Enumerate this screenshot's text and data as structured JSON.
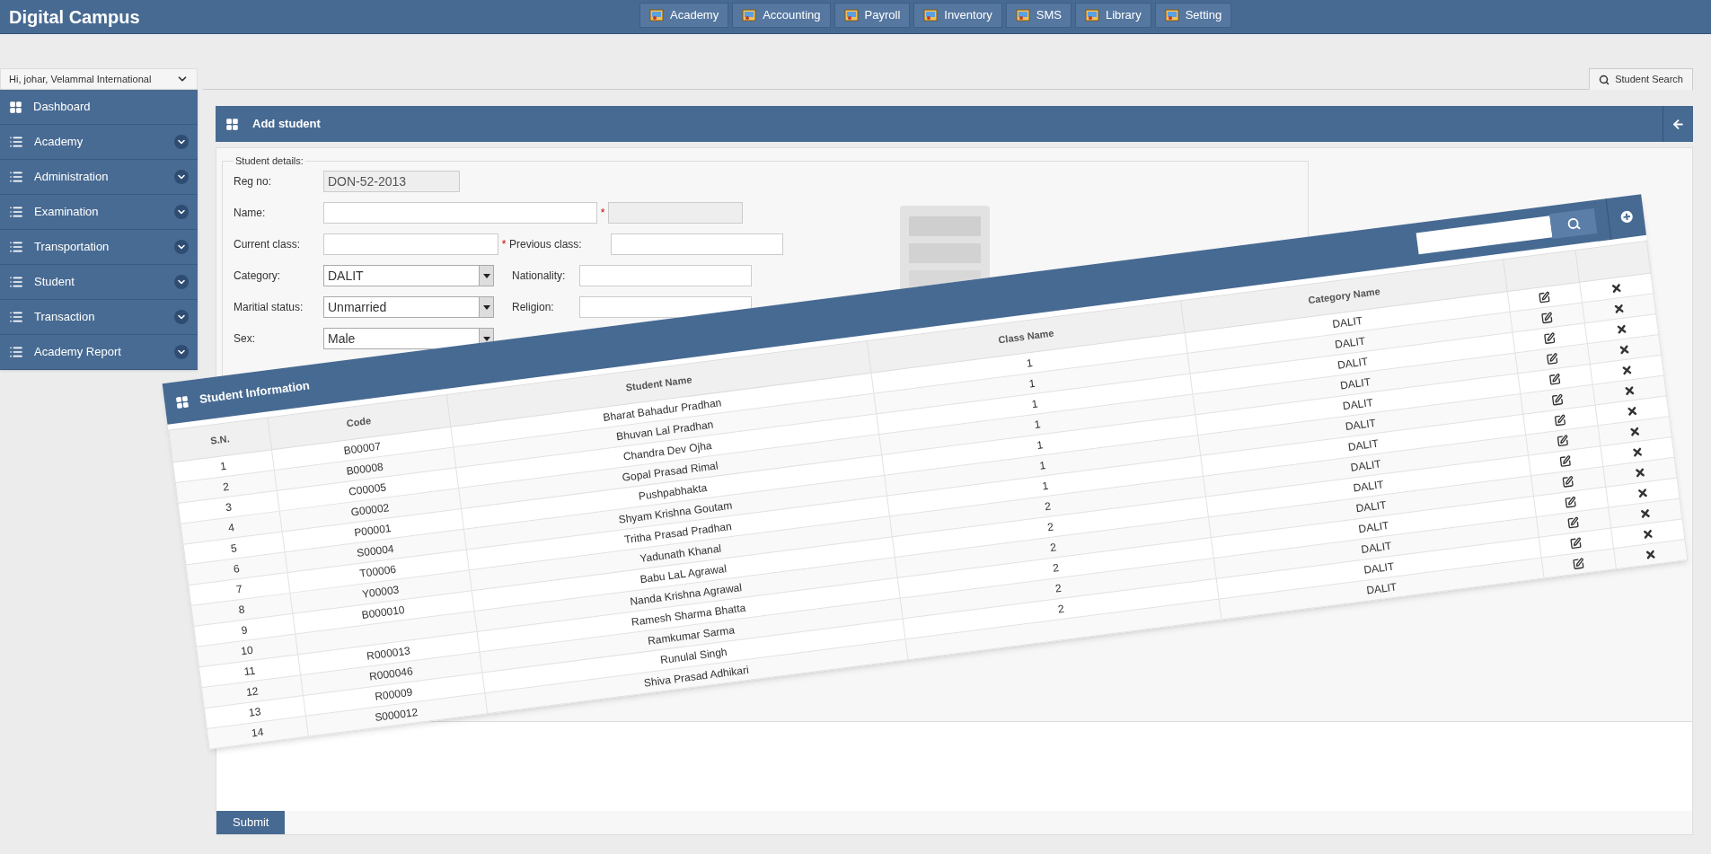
{
  "app": {
    "title": "Digital Campus"
  },
  "top_nav": [
    {
      "label": "Academy"
    },
    {
      "label": "Accounting"
    },
    {
      "label": "Payroll"
    },
    {
      "label": "Inventory"
    },
    {
      "label": "SMS"
    },
    {
      "label": "Library"
    },
    {
      "label": "Setting"
    }
  ],
  "user_menu": {
    "label": "Hi, johar, Velammal International"
  },
  "sidebar": {
    "items": [
      {
        "label": "Dashboard",
        "kind": "link"
      },
      {
        "label": "Academy",
        "kind": "group"
      },
      {
        "label": "Administration",
        "kind": "group"
      },
      {
        "label": "Examination",
        "kind": "group"
      },
      {
        "label": "Transportation",
        "kind": "group"
      },
      {
        "label": "Student",
        "kind": "group"
      },
      {
        "label": "Transaction",
        "kind": "group"
      },
      {
        "label": "Academy Report",
        "kind": "group"
      }
    ]
  },
  "toolbar": {
    "search_button": "Student Search"
  },
  "page": {
    "title": "Add student",
    "fieldset": "Student details:",
    "submit": "Submit",
    "rows": [
      {
        "left": {
          "label": "Reg no:",
          "kind": "readonly",
          "value": "DON-52-2013"
        }
      },
      {
        "left": {
          "label": "Name:",
          "kind": "text",
          "required_mark": "*"
        },
        "right": {
          "kind": "disabled"
        }
      },
      {
        "left": {
          "label": "Current class:",
          "kind": "short",
          "required_mark": "*"
        },
        "right": {
          "label": "Previous class:",
          "kind": "text"
        }
      },
      {
        "left": {
          "label": "Category:",
          "kind": "select",
          "value": "DALIT"
        },
        "right": {
          "label": "Nationality:",
          "kind": "text"
        }
      },
      {
        "left": {
          "label": "Maritial status:",
          "kind": "select",
          "value": "Unmarried"
        },
        "right": {
          "label": "Religion:",
          "kind": "text"
        }
      },
      {
        "left": {
          "label": "Sex:",
          "kind": "select",
          "value": "Male"
        }
      }
    ]
  },
  "overlay": {
    "title": "Student Information",
    "columns": [
      "S.N.",
      "Code",
      "Student Name",
      "Class Name",
      "Category Name"
    ],
    "rows": [
      {
        "sn": "1",
        "code": "B00007",
        "name": "Bharat Bahadur Pradhan",
        "class": "1",
        "category": "DALIT"
      },
      {
        "sn": "2",
        "code": "B00008",
        "name": "Bhuvan Lal Pradhan",
        "class": "1",
        "category": "DALIT"
      },
      {
        "sn": "3",
        "code": "C00005",
        "name": "Chandra Dev Ojha",
        "class": "1",
        "category": "DALIT"
      },
      {
        "sn": "4",
        "code": "G00002",
        "name": "Gopal Prasad Rimal",
        "class": "1",
        "category": "DALIT"
      },
      {
        "sn": "5",
        "code": "P00001",
        "name": "Pushpabhakta",
        "class": "1",
        "category": "DALIT"
      },
      {
        "sn": "6",
        "code": "S00004",
        "name": "Shyam Krishna Goutam",
        "class": "1",
        "category": "DALIT"
      },
      {
        "sn": "7",
        "code": "T00006",
        "name": "Tritha Prasad Pradhan",
        "class": "1",
        "category": "DALIT"
      },
      {
        "sn": "8",
        "code": "Y00003",
        "name": "Yadunath Khanal",
        "class": "2",
        "category": "DALIT"
      },
      {
        "sn": "9",
        "code": "B000010",
        "name": "Babu LaL Agrawal",
        "class": "2",
        "category": "DALIT"
      },
      {
        "sn": "10",
        "name": "Nanda Krishna Agrawal",
        "class": "2",
        "category": "DALIT"
      },
      {
        "sn": "11",
        "code": "R000013",
        "name": "Ramesh Sharma Bhatta",
        "class": "2",
        "category": "DALIT"
      },
      {
        "sn": "12",
        "code": "R000046",
        "name": "Ramkumar Sarma",
        "class": "2",
        "category": "DALIT"
      },
      {
        "sn": "13",
        "code": "R00009",
        "name": "Runulal Singh",
        "class": "2",
        "category": "DALIT"
      },
      {
        "sn": "14",
        "code": "S000012",
        "name": "Shiva Prasad Adhikari",
        "category": "DALIT"
      }
    ]
  }
}
